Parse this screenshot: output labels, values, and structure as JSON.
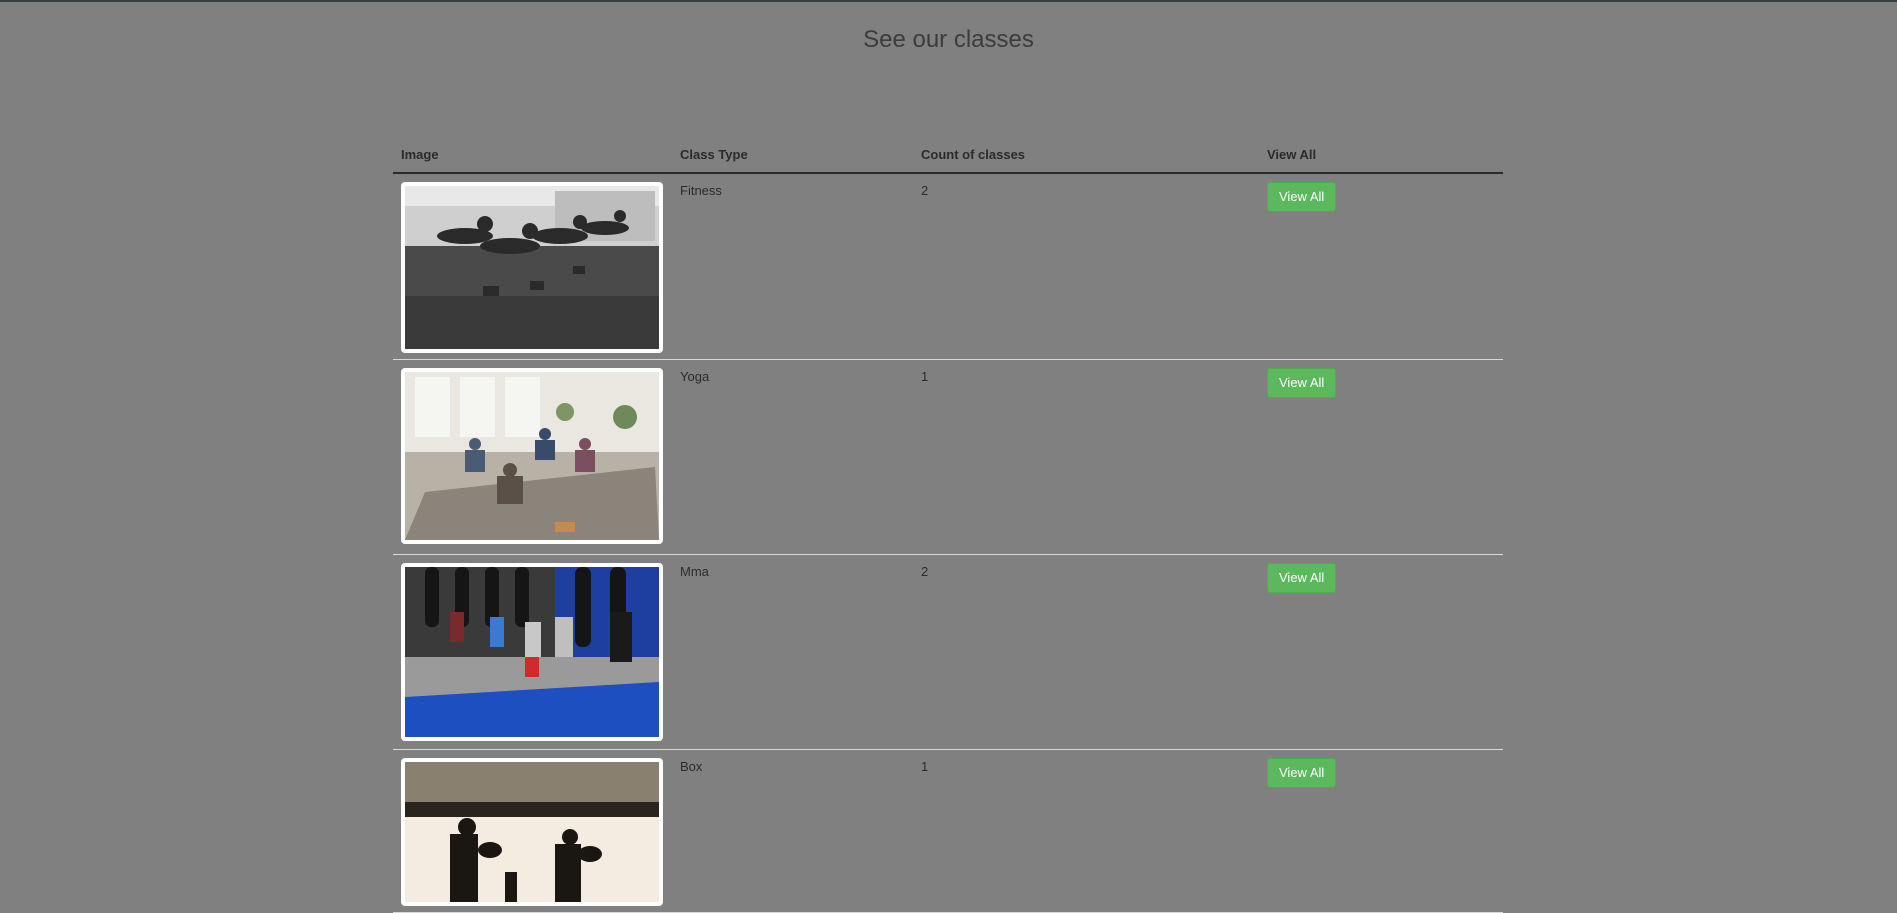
{
  "page": {
    "title": "See our classes"
  },
  "table": {
    "headers": {
      "image": "Image",
      "class_type": "Class Type",
      "count": "Count of classes",
      "view_all": "View All"
    },
    "rows": [
      {
        "class_type": "Fitness",
        "count": "2",
        "button": "View All",
        "image_icon": "fitness-class-photo"
      },
      {
        "class_type": "Yoga",
        "count": "1",
        "button": "View All",
        "image_icon": "yoga-class-photo"
      },
      {
        "class_type": "Mma",
        "count": "2",
        "button": "View All",
        "image_icon": "mma-class-photo"
      },
      {
        "class_type": "Box",
        "count": "1",
        "button": "View All",
        "image_icon": "box-class-photo"
      }
    ]
  },
  "colors": {
    "background": "#808080",
    "button": "#5cb85c",
    "button_text": "#ffffff"
  }
}
